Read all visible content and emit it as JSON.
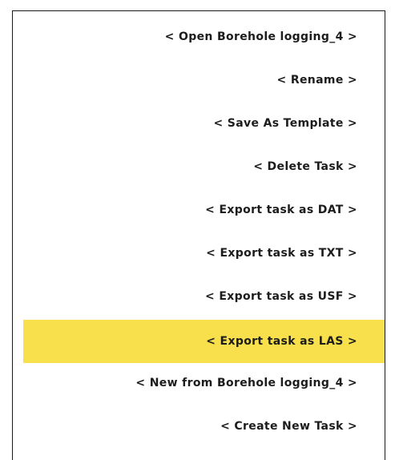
{
  "menu": {
    "selected_index": 7,
    "items": [
      {
        "label": "< Open Borehole logging_4 >"
      },
      {
        "label": "< Rename >"
      },
      {
        "label": "< Save As Template >"
      },
      {
        "label": "< Delete Task >"
      },
      {
        "label": "< Export task as DAT >"
      },
      {
        "label": "< Export task as TXT >"
      },
      {
        "label": "< Export task as USF >"
      },
      {
        "label": "< Export task as LAS >"
      },
      {
        "label": "< New from Borehole logging_4 >"
      },
      {
        "label": "< Create New Task >"
      }
    ]
  },
  "colors": {
    "highlight": "#f7e04b",
    "text": "#1c1c1c",
    "border": "#1a1a1a",
    "background": "#ffffff"
  }
}
